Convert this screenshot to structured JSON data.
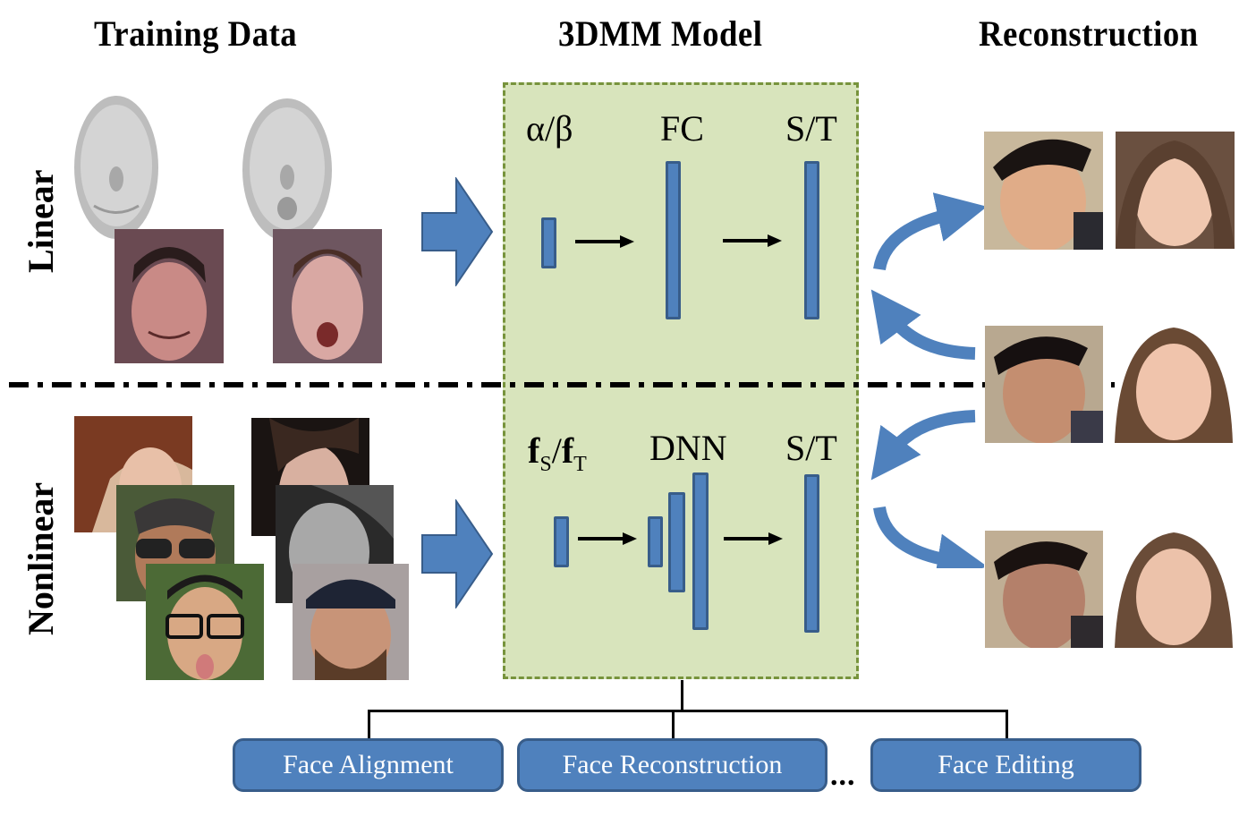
{
  "columns": {
    "training": "Training Data",
    "model": "3DMM Model",
    "reconstruction": "Reconstruction"
  },
  "rows": {
    "linear": "Linear",
    "nonlinear": "Nonlinear"
  },
  "linear_model": {
    "input_label": "α/β",
    "middle_label": "FC",
    "output_label": "S/T"
  },
  "nonlinear_model": {
    "input_label_f1": "f",
    "input_sub1": "S",
    "input_sep": "/",
    "input_label_f2": "f",
    "input_sub2": "T",
    "middle_label": "DNN",
    "output_label": "S/T"
  },
  "training_images": {
    "linear": [
      "3D face scan (smiling)",
      "3D face scan (open mouth)",
      "smiling man photo",
      "surprised woman photo"
    ],
    "nonlinear": [
      "woman in profile with hat",
      "person with sunglasses",
      "man with glasses sticking tongue out",
      "woman with dark hair",
      "grayscale woman looking down",
      "bearded man with cap"
    ]
  },
  "reconstruction_images": [
    "reconstructed man (linear)",
    "reconstructed woman (linear)",
    "input man photo",
    "input woman photo",
    "reconstructed man (nonlinear)",
    "reconstructed woman (nonlinear)"
  ],
  "applications": [
    "Face Alignment",
    "Face Reconstruction",
    "Face Editing"
  ],
  "ellipsis": "...",
  "colors": {
    "model_fill": "#d8e4bc",
    "model_border": "#77933c",
    "accent_blue": "#4f81bd",
    "accent_blue_dark": "#385d8a"
  }
}
